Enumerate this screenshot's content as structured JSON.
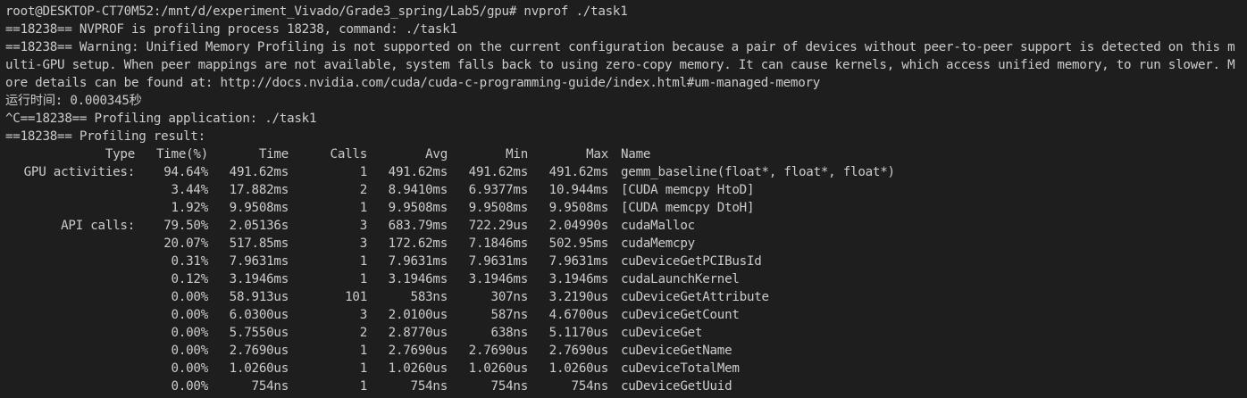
{
  "terminal": {
    "prompt_line": "root@DESKTOP-CT70M52:/mnt/d/experiment_Vivado/Grade3_spring/Lab5/gpu# nvprof ./task1",
    "nvprof_line": "==18238== NVPROF is profiling process 18238, command: ./task1",
    "warning_text": "==18238== Warning: Unified Memory Profiling is not supported on the current configuration because a pair of devices without peer-to-peer support is detected on this multi-GPU setup. When peer mappings are not available, system falls back to using zero-copy memory. It can cause kernels, which access unified memory, to run slower. More details can be found at: http://docs.nvidia.com/cuda/cuda-c-programming-guide/index.html#um-managed-memory",
    "runtime_line": "运行时间: 0.000345秒",
    "app_line": "^C==18238== Profiling application: ./task1",
    "result_line": "==18238== Profiling result:"
  },
  "table": {
    "headers": [
      "Type",
      "Time(%)",
      "Time",
      "Calls",
      "Avg",
      "Min",
      "Max",
      "Name"
    ],
    "rows": [
      [
        "GPU activities:",
        "94.64%",
        "491.62ms",
        "1",
        "491.62ms",
        "491.62ms",
        "491.62ms",
        "gemm_baseline(float*, float*, float*)"
      ],
      [
        "",
        "3.44%",
        "17.882ms",
        "2",
        "8.9410ms",
        "6.9377ms",
        "10.944ms",
        "[CUDA memcpy HtoD]"
      ],
      [
        "",
        "1.92%",
        "9.9508ms",
        "1",
        "9.9508ms",
        "9.9508ms",
        "9.9508ms",
        "[CUDA memcpy DtoH]"
      ],
      [
        "API calls:",
        "79.50%",
        "2.05136s",
        "3",
        "683.79ms",
        "722.29us",
        "2.04990s",
        "cudaMalloc"
      ],
      [
        "",
        "20.07%",
        "517.85ms",
        "3",
        "172.62ms",
        "7.1846ms",
        "502.95ms",
        "cudaMemcpy"
      ],
      [
        "",
        "0.31%",
        "7.9631ms",
        "1",
        "7.9631ms",
        "7.9631ms",
        "7.9631ms",
        "cuDeviceGetPCIBusId"
      ],
      [
        "",
        "0.12%",
        "3.1946ms",
        "1",
        "3.1946ms",
        "3.1946ms",
        "3.1946ms",
        "cudaLaunchKernel"
      ],
      [
        "",
        "0.00%",
        "58.913us",
        "101",
        "583ns",
        "307ns",
        "3.2190us",
        "cuDeviceGetAttribute"
      ],
      [
        "",
        "0.00%",
        "6.0300us",
        "3",
        "2.0100us",
        "587ns",
        "4.6700us",
        "cuDeviceGetCount"
      ],
      [
        "",
        "0.00%",
        "5.7550us",
        "2",
        "2.8770us",
        "638ns",
        "5.1170us",
        "cuDeviceGet"
      ],
      [
        "",
        "0.00%",
        "2.7690us",
        "1",
        "2.7690us",
        "2.7690us",
        "2.7690us",
        "cuDeviceGetName"
      ],
      [
        "",
        "0.00%",
        "1.0260us",
        "1",
        "1.0260us",
        "1.0260us",
        "1.0260us",
        "cuDeviceTotalMem"
      ],
      [
        "",
        "0.00%",
        "754ns",
        "1",
        "754ns",
        "754ns",
        "754ns",
        "cuDeviceGetUuid"
      ]
    ]
  },
  "colors": {
    "background": "#1e1e1e",
    "foreground": "#cccccc"
  }
}
